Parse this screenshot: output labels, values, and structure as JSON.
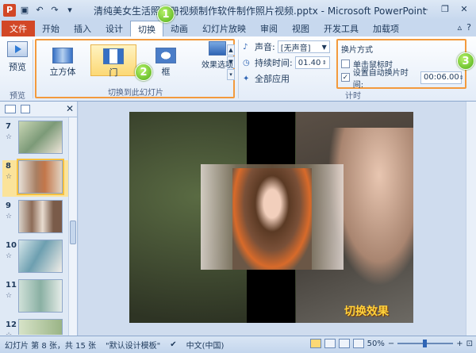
{
  "window": {
    "title": "清纯美女生活照相册视频制作软件制作照片视频.pptx - Microsoft PowerPoint",
    "logo_letter": "P"
  },
  "tabs": {
    "file": "文件",
    "items": [
      "开始",
      "插入",
      "设计",
      "切换",
      "动画",
      "幻灯片放映",
      "审阅",
      "视图",
      "开发工具",
      "加载项"
    ],
    "active": "切换"
  },
  "ribbon": {
    "preview_label": "预览",
    "preview_group": "预览",
    "transitions": [
      {
        "label": "立方体"
      },
      {
        "label": "门"
      },
      {
        "label": "框"
      }
    ],
    "effects_label": "效果选项",
    "transitions_group": "切换到此幻灯片",
    "sound_label": "声音:",
    "sound_value": "[无声音]",
    "duration_label": "持续时间:",
    "duration_value": "01.40",
    "apply_all": "全部应用",
    "advance_title": "换片方式",
    "on_click_label": "单击鼠标时",
    "on_click_checked": false,
    "auto_after_label": "设置自动换片时间:",
    "auto_after_checked": true,
    "auto_after_value": "00:06.00",
    "timing_group": "计时",
    "badges": [
      "1",
      "2",
      "3"
    ]
  },
  "slides_panel": {
    "thumbnails": [
      {
        "number": "7",
        "star": "☆"
      },
      {
        "number": "8",
        "star": "☆"
      },
      {
        "number": "9",
        "star": "☆"
      },
      {
        "number": "10",
        "star": "☆"
      },
      {
        "number": "11",
        "star": "☆"
      },
      {
        "number": "12",
        "star": "☆"
      }
    ],
    "selected": "8"
  },
  "slide": {
    "caption": "切换效果"
  },
  "status": {
    "slide_info": "幻灯片 第 8 张，共 15 张",
    "theme": "\"默认设计模板\"",
    "language": "中文(中国)",
    "zoom": "50%"
  },
  "colors": {
    "file_tab": "#d24726",
    "highlight_border": "#f39a3d",
    "selected_fill": "#fcd875",
    "badge_green": "#4fae16",
    "caption_yellow": "#ffd23c"
  }
}
